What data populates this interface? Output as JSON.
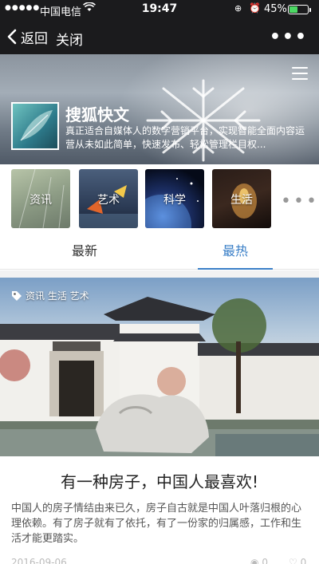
{
  "status_bar": {
    "carrier": "中国电信",
    "time": "19:47",
    "battery": "45%",
    "battery_level": 0.45
  },
  "nav": {
    "back_label": "返回",
    "close_label": "关闭",
    "more_label": "•••"
  },
  "header": {
    "title": "搜狐快文",
    "description": "真正适合自媒体人的数字营销平台，实现智能全面内容运营从未如此简单，快速发布、轻松管理栏目权..."
  },
  "categories": [
    {
      "label": "资讯"
    },
    {
      "label": "艺术"
    },
    {
      "label": "科学"
    },
    {
      "label": "生活"
    }
  ],
  "more_categories_label": "•••",
  "tabs": [
    {
      "label": "最新"
    },
    {
      "label": "最热"
    }
  ],
  "article": {
    "tags": "资讯 生活 艺术",
    "title": "有一种房子，中国人最喜欢!",
    "body": "中国人的房子情结由来已久，房子自古就是中国人叶落归根的心理依赖。有了房子就有了依托，有了一份家的归属感，工作和生活才能更踏实。",
    "date": "2016-09-06",
    "views": "0",
    "likes": "0"
  },
  "colors": {
    "accent": "#3a7fc7",
    "navbar": "#1b1b1d"
  }
}
